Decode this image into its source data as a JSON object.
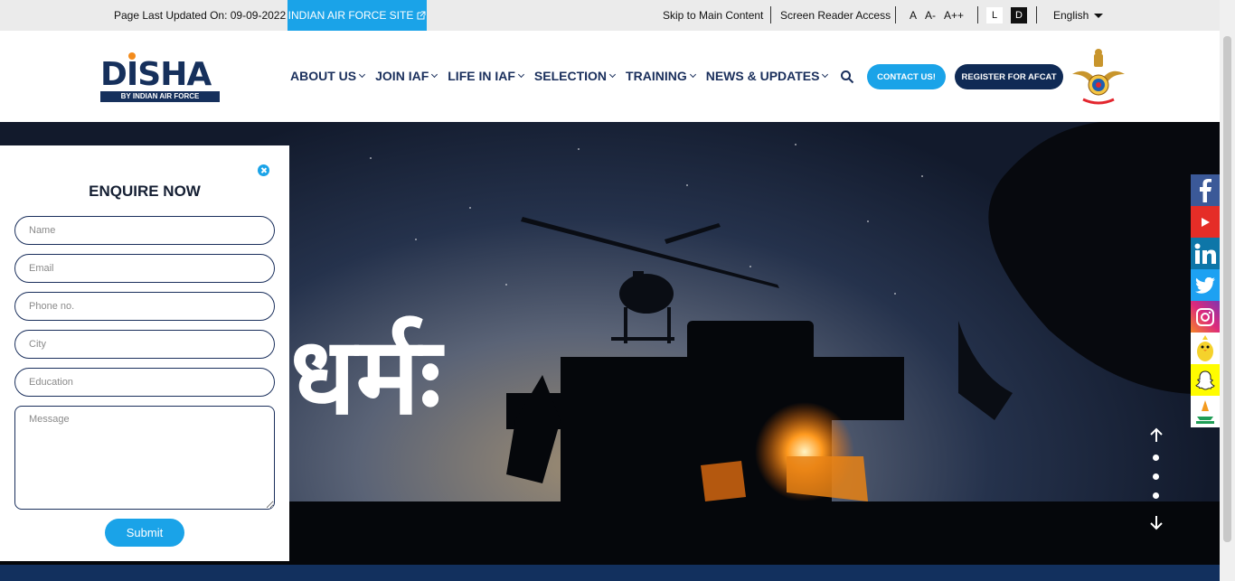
{
  "topbar": {
    "updated": "Page Last Updated On: 09-09-2022",
    "iaf_site": "INDIAN AIR FORCE SITE",
    "skip": "Skip to Main Content",
    "screen_reader": "Screen Reader Access",
    "font_sizes": [
      "A",
      "A-",
      "A++"
    ],
    "mode_light": "L",
    "mode_dark": "D",
    "language": "English"
  },
  "logo": {
    "word": "DISHA",
    "sub": "BY INDIAN AIR FORCE"
  },
  "nav": {
    "items": [
      {
        "label": "ABOUT US"
      },
      {
        "label": "JOIN IAF"
      },
      {
        "label": "LIFE IN IAF"
      },
      {
        "label": "SELECTION"
      },
      {
        "label": "TRAINING"
      },
      {
        "label": "NEWS & UPDATES"
      }
    ],
    "contact": "CONTACT US!",
    "register": "REGISTER FOR AFCAT"
  },
  "hero": {
    "text": "धर्मः"
  },
  "enquiry": {
    "title": "ENQUIRE NOW",
    "placeholders": {
      "name": "Name",
      "email": "Email",
      "phone": "Phone no.",
      "city": "City",
      "education": "Education",
      "message": "Message"
    },
    "submit": "Submit"
  },
  "social": [
    "facebook-icon",
    "youtube-icon",
    "linkedin-icon",
    "twitter-icon",
    "instagram-icon",
    "koo-icon",
    "snapchat-icon",
    "sharechat-icon"
  ],
  "colors": {
    "accent": "#1aa3e8",
    "navy": "#0f2a55",
    "nav_text": "#1a2f5c"
  }
}
